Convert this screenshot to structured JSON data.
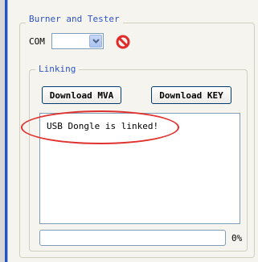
{
  "group": {
    "title": "Burner and Tester"
  },
  "com": {
    "label": "COM",
    "selected": ""
  },
  "linking": {
    "title": "Linking",
    "download_mva_label": "Download MVA",
    "download_key_label": "Download KEY",
    "log": "USB Dongle is linked!"
  },
  "progress": {
    "value": 0,
    "label": "0%"
  },
  "icons": {
    "stop": "stop-icon",
    "dropdown": "chevron-down-icon"
  },
  "colors": {
    "accent": "#2d54c8",
    "annotation": "#e0322e",
    "stop": "#e02a2a"
  }
}
